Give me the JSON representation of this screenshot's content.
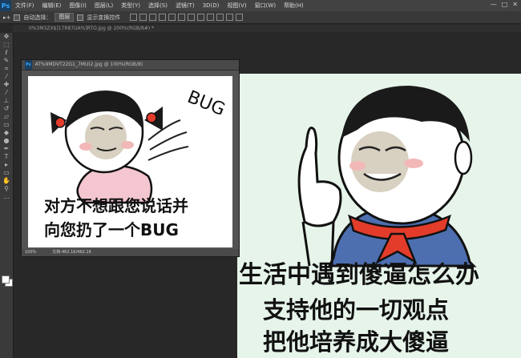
{
  "app": {
    "logo": "Ps",
    "menus": [
      "文件(F)",
      "编辑(E)",
      "图像(I)",
      "图层(L)",
      "类型(Y)",
      "选择(S)",
      "滤镜(T)",
      "3D(D)",
      "视图(V)",
      "窗口(W)",
      "帮助(H)"
    ]
  },
  "window_controls": [
    "—",
    "□",
    "✕"
  ],
  "options": {
    "auto_select_label": "自动选择：",
    "auto_select_value": "图层",
    "show_transform_label": "显示变换控件"
  },
  "document_tab": "0%3M3ZX$]17R87UA%]RTO.jpg @ 200%(RGB/8#) *",
  "floating_window": {
    "title": "AT%9MDVT22G1_7MU(2.jpg @ 100%(RGB/8)",
    "zoom": "100%",
    "doc_size": "文档:462.1K/462.1K"
  },
  "memes": {
    "left": {
      "bug_text": "BUG",
      "line1": "对方不想跟您说话并",
      "line2": "向您扔了一个BUG"
    },
    "right": {
      "line1": "生活中遇到傻逼怎么办",
      "line2": "支持他的一切观点",
      "line3": "把他培养成大傻逼"
    }
  },
  "colors": {
    "menubar": "#424242",
    "optionsbar": "#383838",
    "workspace": "#282828",
    "toolbar": "#3a3a3a",
    "accent": "#31a8ff"
  }
}
